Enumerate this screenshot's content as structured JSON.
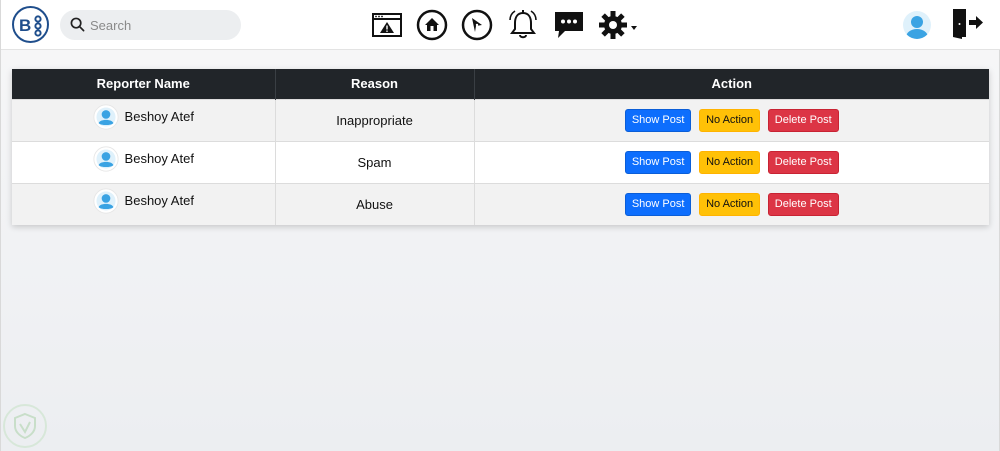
{
  "search": {
    "placeholder": "Search"
  },
  "nav": {
    "icons": [
      "reports-warning-icon",
      "home-icon",
      "explore-compass-icon",
      "notifications-bell-icon",
      "messages-icon",
      "settings-gear-icon"
    ]
  },
  "table": {
    "headers": [
      "Reporter Name",
      "Reason",
      "Action"
    ],
    "rows": [
      {
        "reporter": "Beshoy Atef",
        "reason": "Inappropriate"
      },
      {
        "reporter": "Beshoy Atef",
        "reason": "Spam"
      },
      {
        "reporter": "Beshoy Atef",
        "reason": "Abuse"
      }
    ],
    "actions": {
      "show": "Show Post",
      "no_action": "No Action",
      "delete": "Delete Post"
    }
  },
  "colors": {
    "brand": "#1f4e8c",
    "header_bg": "#212529",
    "primary": "#0d6efd",
    "warning": "#ffc107",
    "danger": "#dc3545"
  }
}
